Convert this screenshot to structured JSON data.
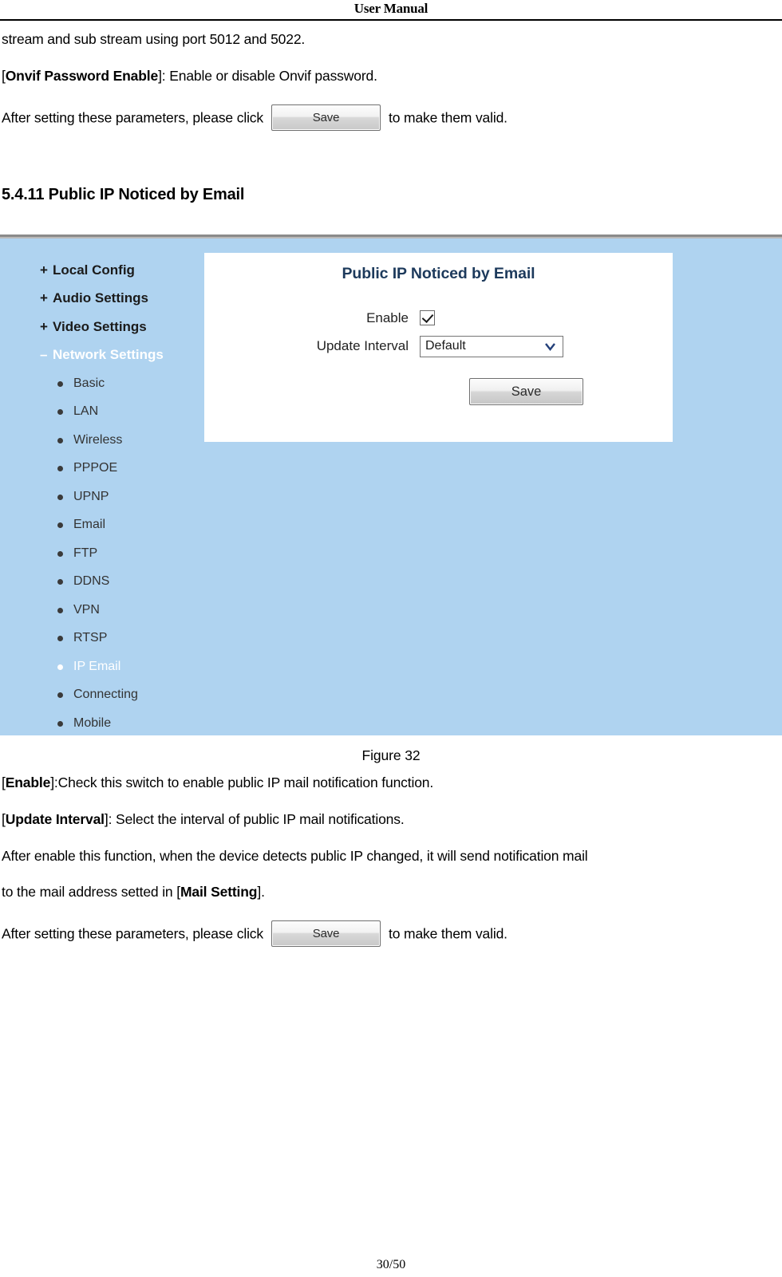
{
  "header": {
    "title": "User Manual"
  },
  "intro": {
    "line1": "stream and sub stream using port 5012 and 5022.",
    "onvif_label": "Onvif Password Enable",
    "onvif_desc": "]: Enable or disable Onvif password.",
    "onvif_open": "[",
    "save_prefix": "After setting these parameters, please click",
    "save_button": "Save",
    "save_suffix": "to make them valid."
  },
  "section": {
    "heading": "5.4.11 Public IP Noticed by Email"
  },
  "screenshot": {
    "panel_title": "Public IP Noticed by Email",
    "sidebar": {
      "groups": [
        {
          "sign": "+",
          "label": "Local Config",
          "active": false
        },
        {
          "sign": "+",
          "label": "Audio Settings",
          "active": false
        },
        {
          "sign": "+",
          "label": "Video Settings",
          "active": false
        },
        {
          "sign": "–",
          "label": "Network Settings",
          "active": true
        }
      ],
      "items": [
        {
          "label": "Basic",
          "active": false
        },
        {
          "label": "LAN",
          "active": false
        },
        {
          "label": "Wireless",
          "active": false
        },
        {
          "label": "PPPOE",
          "active": false
        },
        {
          "label": "UPNP",
          "active": false
        },
        {
          "label": "Email",
          "active": false
        },
        {
          "label": "FTP",
          "active": false
        },
        {
          "label": "DDNS",
          "active": false
        },
        {
          "label": "VPN",
          "active": false
        },
        {
          "label": "RTSP",
          "active": false
        },
        {
          "label": "IP Email",
          "active": true
        },
        {
          "label": "Connecting",
          "active": false
        },
        {
          "label": "Mobile",
          "active": false
        }
      ]
    },
    "form": {
      "enable_label": "Enable",
      "enable_checked": true,
      "interval_label": "Update Interval",
      "interval_value": "Default",
      "save_label": "Save"
    },
    "colors": {
      "background": "#afd3f0",
      "panel": "#ffffff",
      "title_text": "#1d3a5c",
      "active_text": "#ffffff"
    }
  },
  "figure": {
    "caption": "Figure 32"
  },
  "explain": {
    "enable_open": "[",
    "enable_label": "Enable",
    "enable_desc": "]:Check this switch to enable public IP mail notification function.",
    "interval_open": "[",
    "interval_label": "Update Interval",
    "interval_desc": "]: Select the interval of public IP mail notifications.",
    "para_line1": "After enable this function, when the device detects public IP changed, it will send notification mail",
    "para_line2_pre": "to the mail address setted in ",
    "para_line2_open": "[",
    "para_line2_label": "Mail Setting",
    "para_line2_post": "].",
    "save_prefix": "After setting these parameters, please click",
    "save_button": "Save",
    "save_suffix": "to make them valid."
  },
  "footer": {
    "page": "30/50"
  }
}
